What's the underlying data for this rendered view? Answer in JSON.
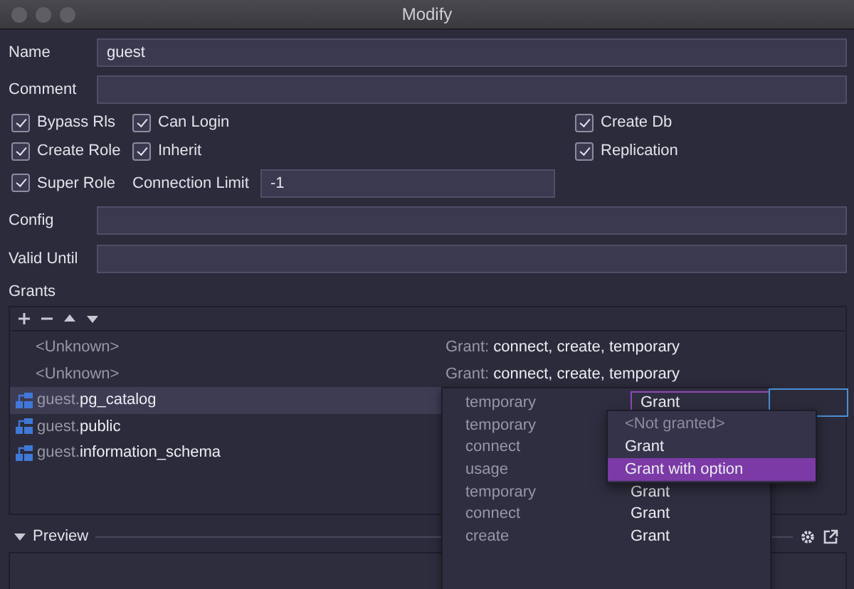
{
  "window": {
    "title": "Modify"
  },
  "fields": [
    {
      "label": "Name",
      "value": "guest"
    },
    {
      "label": "Comment"
    }
  ],
  "flag_rows": [
    {
      "left": [
        {
          "label": "Bypass Rls",
          "checked": true
        },
        {
          "label": "Can Login",
          "checked": true
        }
      ],
      "right": [
        {
          "label": "Create Db",
          "checked": true
        }
      ]
    },
    {
      "left": [
        {
          "label": "Create Role",
          "checked": true
        },
        {
          "label": "Inherit",
          "checked": true
        }
      ],
      "right": [
        {
          "label": "Replication",
          "checked": true
        }
      ]
    },
    {
      "left": [
        {
          "label": "Super Role",
          "checked": true
        }
      ],
      "right": []
    }
  ],
  "connection_limit": {
    "label": "Connection Limit",
    "value": "-1"
  },
  "more_fields": [
    {
      "label": "Config"
    },
    {
      "label": "Valid Until"
    }
  ],
  "grants": {
    "label": "Grants",
    "rows": [
      {
        "kind": "unknown",
        "object": "<Unknown>",
        "grant_label": "Grant:",
        "grant_value": "connect, create, temporary",
        "selected": false
      },
      {
        "kind": "unknown",
        "object": "<Unknown>",
        "grant_label": "Grant:",
        "grant_value": "connect, create, temporary",
        "selected": false
      },
      {
        "kind": "schema",
        "owner": "guest.",
        "object": "pg_catalog",
        "selected": true
      },
      {
        "kind": "schema",
        "owner": "guest.",
        "object": "public",
        "selected": false
      },
      {
        "kind": "schema",
        "owner": "guest.",
        "object": "information_schema",
        "selected": false
      }
    ]
  },
  "privileges": [
    {
      "kind": "combo",
      "privilege": "temporary",
      "value": "Grant"
    },
    {
      "kind": "plain",
      "privilege": "temporary"
    },
    {
      "kind": "plain",
      "privilege": "connect"
    },
    {
      "kind": "plain",
      "privilege": "usage"
    },
    {
      "kind": "plain",
      "privilege": "temporary",
      "value": "Grant"
    },
    {
      "kind": "plain",
      "privilege": "connect",
      "value": "Grant"
    },
    {
      "kind": "plain",
      "privilege": "create",
      "value": "Grant"
    }
  ],
  "dropdown_options": [
    {
      "label": "<Not granted>",
      "disabled": true,
      "selected": false
    },
    {
      "label": "Grant",
      "disabled": false,
      "selected": false
    },
    {
      "label": "Grant with option",
      "disabled": false,
      "selected": true
    }
  ],
  "preview": {
    "label": "Preview",
    "expanded": true
  }
}
